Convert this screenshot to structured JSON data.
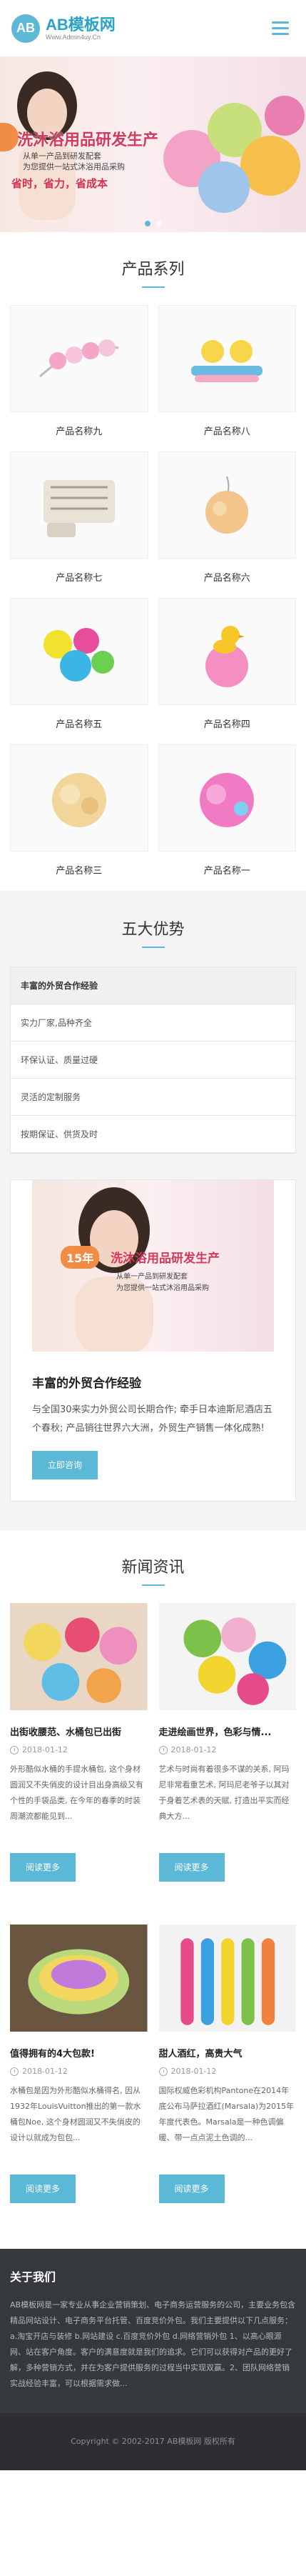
{
  "header": {
    "logo_mark": "AB",
    "logo_name": "AB模板网",
    "logo_domain": "Www.Admin4uy.Cn"
  },
  "banner": {
    "title": "洗沐浴用品研发生产",
    "sub1": "从单一产品到研发配套",
    "sub2": "为您提供一站式沐浴用品采购",
    "slogan": "省时，省力，省成本"
  },
  "products": {
    "title": "产品系列",
    "items": [
      {
        "name": "产品名称九",
        "icon": "bath-strap-image"
      },
      {
        "name": "产品名称八",
        "icon": "towel-set-image"
      },
      {
        "name": "产品名称七",
        "icon": "striped-towel-image"
      },
      {
        "name": "产品名称六",
        "icon": "bath-puff-image"
      },
      {
        "name": "产品名称五",
        "icon": "sponge-set-image"
      },
      {
        "name": "产品名称四",
        "icon": "duck-sponge-image"
      },
      {
        "name": "产品名称三",
        "icon": "yellow-puff-image"
      },
      {
        "name": "产品名称一",
        "icon": "pink-puff-image"
      }
    ]
  },
  "advantages": {
    "title": "五大优势",
    "items": [
      "丰富的外贸合作经验",
      "实力厂家,品种齐全",
      "环保认证、质量过硬",
      "灵活的定制服务",
      "按期保证、供货及时"
    ],
    "card": {
      "banner_year": "15年",
      "banner_title": "洗沐浴用品研发生产",
      "banner_sub1": "从单一产品到研发配套",
      "banner_sub2": "为您提供一站式沐浴用品采购",
      "title": "丰富的外贸合作经验",
      "text": "与全国30来实力外贸公司长期合作; 牵手日本迪斯尼酒店五个春秋; 产品销往世界六大洲，外贸生产销售一体化成熟!",
      "button": "立即咨询"
    }
  },
  "news": {
    "title": "新闻资讯",
    "items": [
      {
        "title": "出街收腰范、水桶包已出街",
        "date": "2018-01-12",
        "text": "外形酷似水桶的手提水桶包, 这个身材圆润又不失俏皮的设计目出身高级又有个性的手袋品类, 在今年的春季的时装周潮流都能见到...",
        "button": "阅读更多"
      },
      {
        "title": "走进绘画世界，色彩与情...",
        "date": "2018-01-12",
        "text": "艺术与时尚有着很多不谋的关系, 阿玛尼非常看重艺术, 阿玛尼老爷子以其对于身着艺术表的天赋, 打造出平实而经典大方...",
        "button": "阅读更多"
      },
      {
        "title": "值得拥有的4大包款!",
        "date": "2018-01-12",
        "text": "水桶包是因为外形酷似水桶得名, 因从1932年LouisVuitton推出的第一款水桶包Noe, 这个身材圆润又不失俏皮的设计以就成为包包...",
        "button": "阅读更多"
      },
      {
        "title": "甜人酒红，高贵大气",
        "date": "2018-01-12",
        "text": "国际权威色彩机构Pantone在2014年底公布马萨拉酒红(Marsala)为2015年年度代表色。Marsala是一种色调偏暖、带一点点泥土色调的...",
        "button": "阅读更多"
      }
    ]
  },
  "about": {
    "title": "关于我们",
    "text": "AB模板网是一家专业从事企业营销策划、电子商务运营服务的公司，主要业务包含精品网站设计、电子商务平台托管、百度竞价外包。我们主要提供以下几点服务：a.淘宝开店与装修 b.网站建设 c.百度竞价外包 d.网络营销外包 1、以高心眼源网、站在客户角度。客户的满意度就是我们的追求。它们可以获得对产品的更好了解，多种营销方式，并在为客户提供服务的过程当中实现双赢。2、团队网络营销实战经验丰富，可以根据需求做..."
  },
  "footer": {
    "copyright": "Copyright © 2002-2017 AB模板网 版权所有"
  }
}
